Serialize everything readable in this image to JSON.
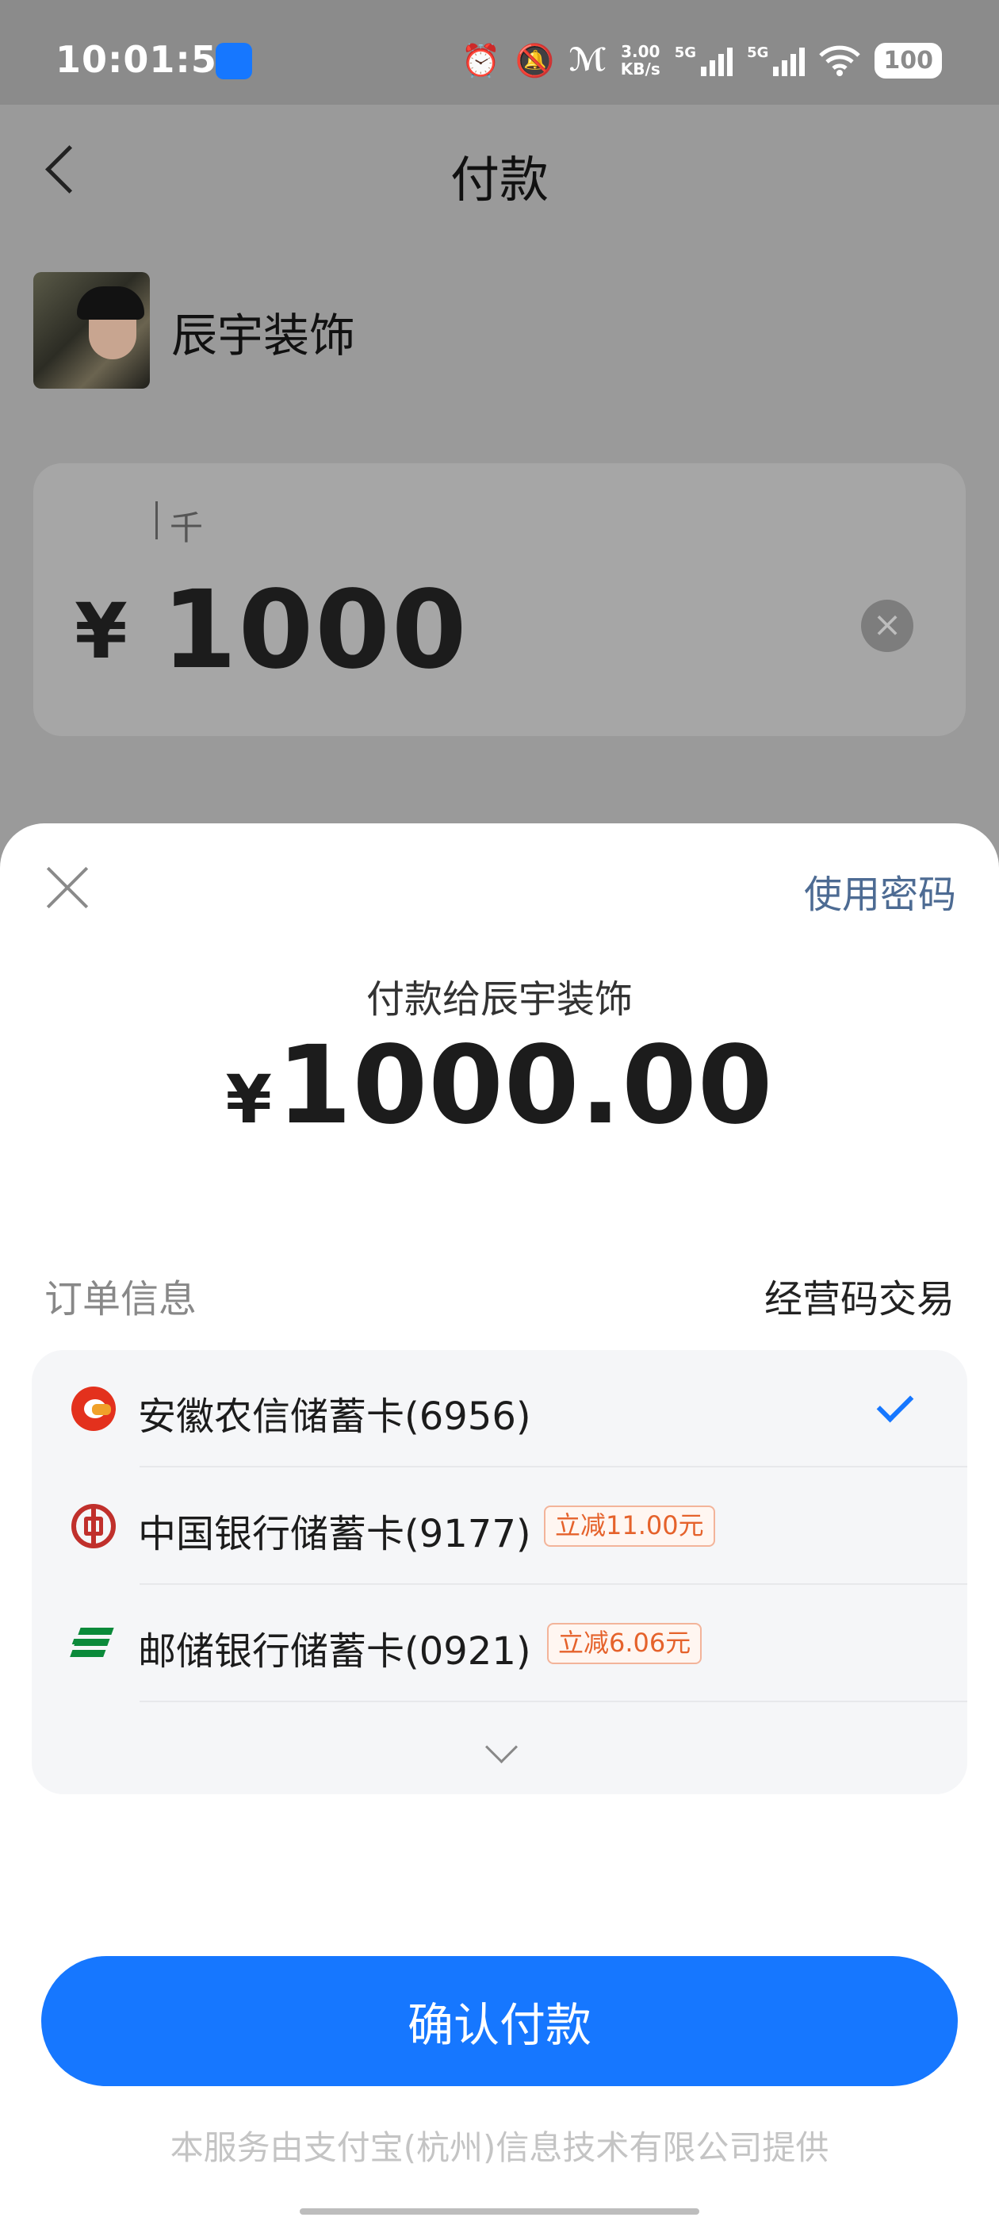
{
  "status_bar": {
    "time": "10:01:53",
    "net_speed_value": "3.00",
    "net_speed_unit": "KB/s",
    "sim1_label": "5G",
    "sim2_label": "5G",
    "battery": "100"
  },
  "header": {
    "title": "付款"
  },
  "merchant": {
    "name": "辰宇装饰"
  },
  "amount_input": {
    "unit_label": "千",
    "currency": "¥",
    "value": "1000"
  },
  "sheet": {
    "use_password_label": "使用密码",
    "pay_to_label": "付款给辰宇装饰",
    "currency": "¥",
    "amount": "1000.00",
    "order_info_label": "订单信息",
    "order_info_value": "经营码交易",
    "payment_methods": [
      {
        "label": "安徽农信储蓄卡(6956)",
        "selected": true,
        "promo": ""
      },
      {
        "label": "中国银行储蓄卡(9177)",
        "selected": false,
        "promo": "立减11.00元"
      },
      {
        "label": "邮储银行储蓄卡(0921)",
        "selected": false,
        "promo": "立减6.06元"
      }
    ],
    "confirm_label": "确认付款",
    "footer_note": "本服务由支付宝(杭州)信息技术有限公司提供"
  },
  "colors": {
    "accent": "#1677ff",
    "promo_text": "#e5622b",
    "link_text": "#4d6b93"
  }
}
